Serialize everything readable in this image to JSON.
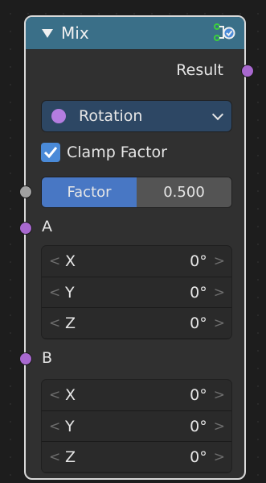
{
  "node": {
    "title": "Mix",
    "output_label": "Result",
    "data_type": "Rotation",
    "clamp_label": "Clamp Factor",
    "clamp_checked": true,
    "factor": {
      "label": "Factor",
      "value": "0.500",
      "fraction": 0.5
    },
    "inputs": [
      {
        "name": "A",
        "rows": [
          {
            "axis": "X",
            "value": "0°"
          },
          {
            "axis": "Y",
            "value": "0°"
          },
          {
            "axis": "Z",
            "value": "0°"
          }
        ]
      },
      {
        "name": "B",
        "rows": [
          {
            "axis": "X",
            "value": "0°"
          },
          {
            "axis": "Y",
            "value": "0°"
          },
          {
            "axis": "Z",
            "value": "0°"
          }
        ]
      }
    ],
    "arrow_left": "<",
    "arrow_right": ">"
  },
  "colors": {
    "header": "#3a6f88",
    "rotation_socket": "#a868cf",
    "float_socket": "#a1a1a1",
    "factor_fill": "#4877c4",
    "dropdown_bg": "#2d4764",
    "checkbox": "#4a8ad8"
  },
  "icons": [
    "collapse-arrow-icon",
    "node-group-icon",
    "chevron-down-icon",
    "checkmark-icon"
  ]
}
